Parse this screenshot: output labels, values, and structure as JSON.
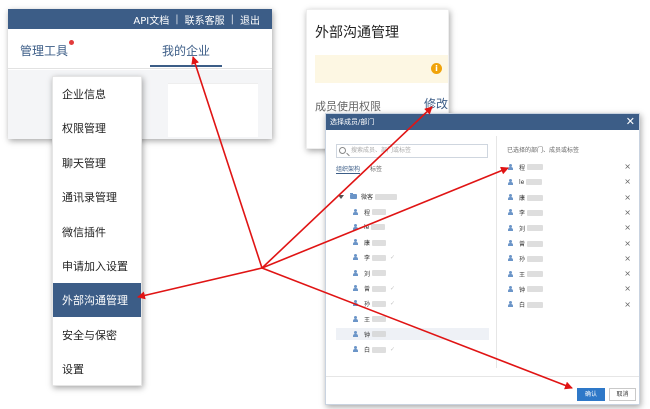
{
  "topbar": {
    "links": [
      "API文档",
      "联系客服",
      "退出"
    ]
  },
  "admin_tabs": {
    "tools_label": "管理工具",
    "enterprise_label": "我的企业"
  },
  "side_menu": {
    "items": [
      {
        "label": "企业信息",
        "active": false
      },
      {
        "label": "权限管理",
        "active": false
      },
      {
        "label": "聊天管理",
        "active": false
      },
      {
        "label": "通讯录管理",
        "active": false
      },
      {
        "label": "微信插件",
        "active": false
      },
      {
        "label": "申请加入设置",
        "active": false
      },
      {
        "label": "外部沟通管理",
        "active": true
      },
      {
        "label": "安全与保密",
        "active": false
      },
      {
        "label": "设置",
        "active": false
      }
    ]
  },
  "ext_panel": {
    "title": "外部沟通管理",
    "warning_icon": "info-icon",
    "member_permission_label": "成员使用权限",
    "modify_label": "修改"
  },
  "dialog": {
    "title": "选择成员/部门",
    "close_symbol": "✕",
    "search_placeholder": "搜索成员、部门或标签",
    "tab_org": "组织架构",
    "tab_tags": "标签",
    "tree_root_label": "微客",
    "tree_members": [
      "程",
      "le",
      "康",
      "李",
      "刘",
      "曾",
      "孙",
      "王",
      "钟",
      "白"
    ],
    "selected_title": "已选择的部门、成员或标签",
    "selected_members": [
      "程",
      "le",
      "康",
      "李",
      "刘",
      "曾",
      "孙",
      "王",
      "钟",
      "白"
    ],
    "confirm_label": "确认",
    "cancel_label": "取消"
  },
  "colors": {
    "brand": "#3c5d87",
    "confirm": "#2e78c8",
    "arrow": "#e01414",
    "warning_bg": "#fdf7e3",
    "warning_icon": "#f0a30a"
  }
}
